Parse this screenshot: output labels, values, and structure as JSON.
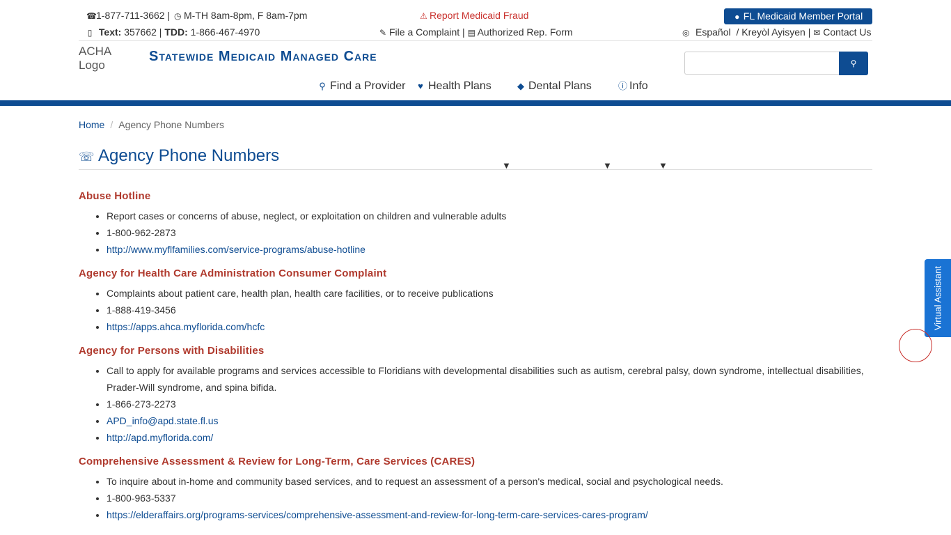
{
  "topbar": {
    "phone": "1-877-711-3662 |",
    "hours": "M-TH 8am-8pm, F 8am-7pm",
    "fraud_link": "Report Medicaid Fraud",
    "portal_button": "FL Medicaid Member Portal",
    "text_label": "Text:",
    "text_value": "357662 |",
    "tdd_label": "TDD:",
    "tdd_value": "1-866-467-4970",
    "complaint_link": "File a Complaint |",
    "rep_form_link": "Authorized Rep. Form",
    "espanol_link": "Español",
    "kreyol_link": "/ Kreyòl Ayisyen |",
    "contact_link": "Contact Us"
  },
  "header": {
    "logo_alt": "ACHA Logo",
    "site_title": "Statewide Medicaid Managed Care",
    "search_placeholder": ""
  },
  "nav": {
    "items": [
      {
        "label": "Find a Provider"
      },
      {
        "label": "Health Plans"
      },
      {
        "label": "Dental Plans"
      },
      {
        "label": "Info"
      }
    ]
  },
  "breadcrumb": {
    "home": "Home",
    "current": "Agency Phone Numbers"
  },
  "page": {
    "title": "Agency Phone Numbers"
  },
  "sections": [
    {
      "title": "Abuse Hotline",
      "items": [
        {
          "text": "Report cases or concerns of abuse, neglect, or exploitation on children and vulnerable adults",
          "link": false
        },
        {
          "text": "1-800-962-2873",
          "link": false
        },
        {
          "text": "http://www.myflfamilies.com/service-programs/abuse-hotline",
          "link": true
        }
      ]
    },
    {
      "title": "Agency for Health Care Administration Consumer Complaint",
      "items": [
        {
          "text": "Complaints about patient care, health plan, health care facilities, or to receive publications",
          "link": false
        },
        {
          "text": "1-888-419-3456",
          "link": false
        },
        {
          "text": "https://apps.ahca.myflorida.com/hcfc",
          "link": true
        }
      ]
    },
    {
      "title": "Agency for Persons with Disabilities",
      "items": [
        {
          "text": "Call to apply for available programs and services accessible to Floridians with developmental disabilities such as autism, cerebral palsy, down syndrome, intellectual disabilities, Prader-Will syndrome, and spina bifida.",
          "link": false
        },
        {
          "text": "1-866-273-2273",
          "link": false
        },
        {
          "text": "APD_info@apd.state.fl.us",
          "link": true
        },
        {
          "text": "http://apd.myflorida.com/",
          "link": true
        }
      ]
    },
    {
      "title": "Comprehensive Assessment & Review for Long-Term, Care Services (CARES)",
      "items": [
        {
          "text": "To inquire about in-home and community based services, and to request an assessment of a person's medical, social and psychological needs.",
          "link": false
        },
        {
          "text": "1-800-963-5337",
          "link": false
        },
        {
          "text": "https://elderaffairs.org/programs-services/comprehensive-assessment-and-review-for-long-term-care-services-cares-program/",
          "link": true
        }
      ]
    }
  ],
  "virtual_assistant": {
    "label": "Virtual Assistant"
  },
  "colors": {
    "brand_blue": "#0e4c92",
    "heading_red": "#b03a2e",
    "fraud_red": "#c9302c",
    "assistant_blue": "#1a73d4"
  }
}
